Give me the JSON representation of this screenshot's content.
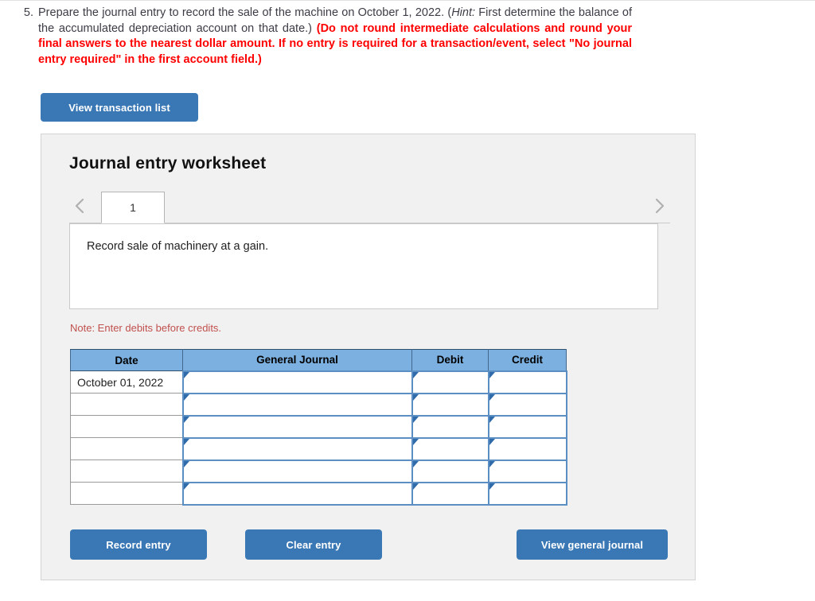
{
  "question": {
    "number": "5.",
    "text_part1": "Prepare the journal entry to record the sale of the machine on October 1, 2022. (",
    "hint_label": "Hint:",
    "text_part2": " First determine the balance of the accumulated depreciation account on that date.) ",
    "red_text": "(Do not round intermediate calculations and round your final answers to the nearest dollar amount. If no entry is required for a transaction/event, select \"No journal entry required\" in the first account field.)"
  },
  "toolbar": {
    "view_transaction_list_label": "View transaction list"
  },
  "worksheet": {
    "title": "Journal entry worksheet",
    "prev_icon": "chevron-left-icon",
    "next_icon": "chevron-right-icon",
    "tabs": [
      {
        "label": "1",
        "active": true
      }
    ],
    "description": "Record sale of machinery at a gain.",
    "note": "Note: Enter debits before credits."
  },
  "table": {
    "headers": [
      "Date",
      "General Journal",
      "Debit",
      "Credit"
    ],
    "rows": [
      {
        "date": "October 01, 2022",
        "general_journal": "",
        "debit": "",
        "credit": ""
      },
      {
        "date": "",
        "general_journal": "",
        "debit": "",
        "credit": ""
      },
      {
        "date": "",
        "general_journal": "",
        "debit": "",
        "credit": ""
      },
      {
        "date": "",
        "general_journal": "",
        "debit": "",
        "credit": ""
      },
      {
        "date": "",
        "general_journal": "",
        "debit": "",
        "credit": ""
      },
      {
        "date": "",
        "general_journal": "",
        "debit": "",
        "credit": ""
      }
    ]
  },
  "footer": {
    "record_entry_label": "Record entry",
    "clear_entry_label": "Clear entry",
    "view_general_journal_label": "View general journal"
  },
  "colors": {
    "button_blue": "#3a78b5",
    "table_header_blue": "#7cb0e0",
    "input_border_blue": "#5b8fc4",
    "note_red": "#c0504d",
    "warning_red": "#ff0000",
    "panel_bg": "#f1f1f1"
  }
}
